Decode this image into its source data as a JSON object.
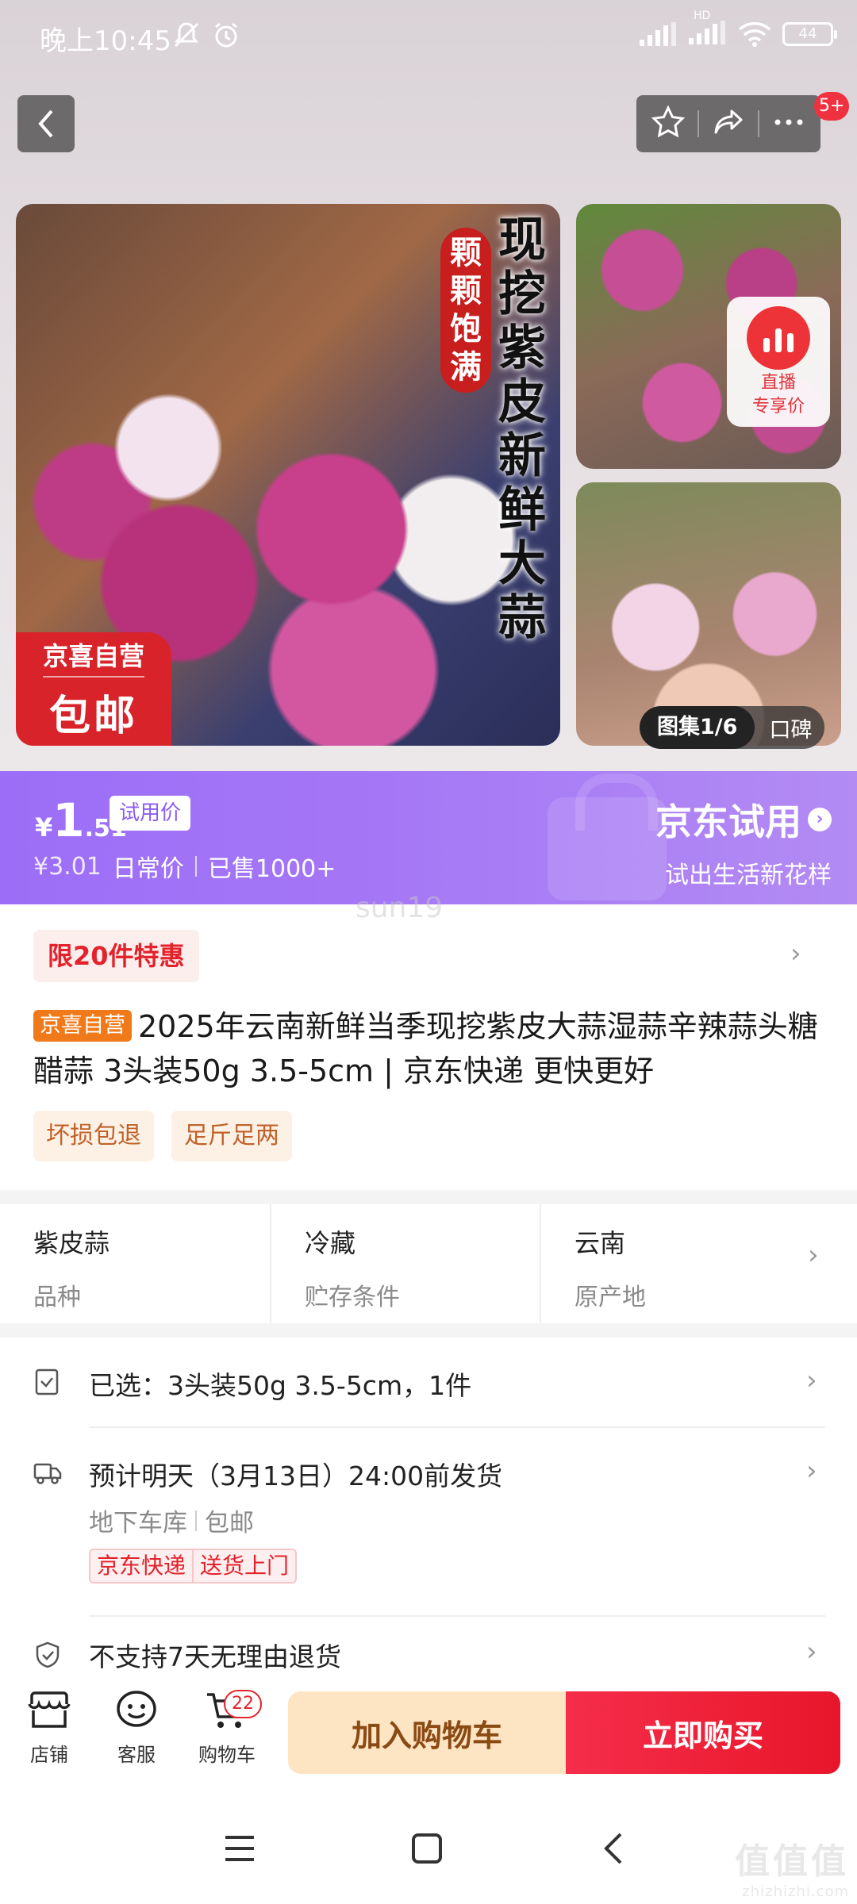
{
  "status_bar": {
    "time": "晚上10:45",
    "signal_label": "HD",
    "battery": "44"
  },
  "header": {
    "notif_badge": "5+"
  },
  "gallery": {
    "vertical_title": "现挖紫皮新鲜大蒜",
    "vertical_sub": "颗颗饱满",
    "corner_line1": "京喜自营",
    "corner_line2": "包邮",
    "live_label_1": "直播",
    "live_label_2": "专享价",
    "album_label": "图集1/6",
    "review_label": "口碑"
  },
  "price": {
    "currency": "¥",
    "integer": "1",
    "decimal": ".51",
    "tag": "试用价",
    "original": "¥3.01",
    "original_label": "日常价",
    "sold": "已售1000+",
    "promo_title": "京东试用",
    "promo_subtitle": "试出生活新花样"
  },
  "watermark_user": "sun19",
  "product": {
    "limit_chip": "限20件特惠",
    "self_tag": "京喜自营",
    "title": "2025年云南新鲜当季现挖紫皮大蒜湿蒜辛辣蒜头糖醋蒜 3头装50g 3.5-5cm | 京东快递 更快更好",
    "service_tags": [
      "坏损包退",
      "足斤足两"
    ]
  },
  "attributes": [
    {
      "value": "紫皮蒜",
      "key": "品种"
    },
    {
      "value": "冷藏",
      "key": "贮存条件"
    },
    {
      "value": "云南",
      "key": "原产地"
    }
  ],
  "options": {
    "selected": "已选：3头装50g 3.5-5cm，1件",
    "delivery": "预计明天（3月13日）24:00前发货",
    "warehouse": "地下车库",
    "shipping": "包邮",
    "express_1": "京东快递",
    "express_2": "送货上门",
    "return_policy": "不支持7天无理由退货"
  },
  "bottom_bar": {
    "store": "店铺",
    "service": "客服",
    "cart": "购物车",
    "cart_count": "22",
    "add_to_cart": "加入购物车",
    "buy_now": "立即购买"
  },
  "watermark": {
    "site_logo": "值值值",
    "site_url": "zhizhizhi.com"
  },
  "colors": {
    "brand_red": "#e3222b",
    "trial_purple": "#a577f6",
    "cart_button": "#fde4c2"
  }
}
